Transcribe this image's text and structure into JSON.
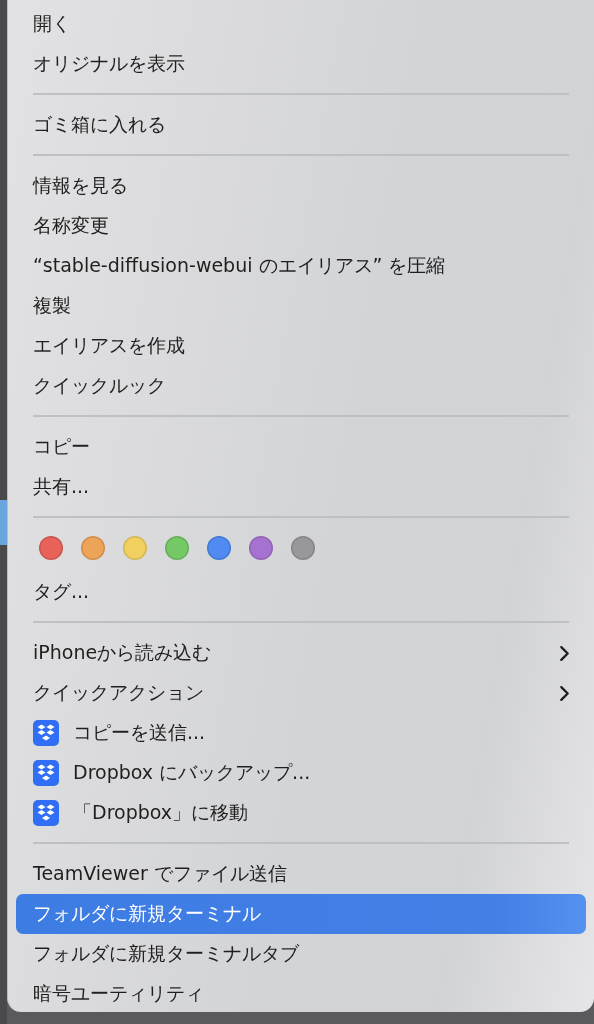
{
  "menu": {
    "items": [
      {
        "kind": "item",
        "label": "開く",
        "selected": false
      },
      {
        "kind": "item",
        "label": "オリジナルを表示",
        "selected": false
      },
      {
        "kind": "separator"
      },
      {
        "kind": "item",
        "label": "ゴミ箱に入れる",
        "selected": false
      },
      {
        "kind": "separator"
      },
      {
        "kind": "item",
        "label": "情報を見る",
        "selected": false
      },
      {
        "kind": "item",
        "label": "名称変更",
        "selected": false
      },
      {
        "kind": "item",
        "label": "“stable-diffusion-webui のエイリアス” を圧縮",
        "selected": false
      },
      {
        "kind": "item",
        "label": "複製",
        "selected": false
      },
      {
        "kind": "item",
        "label": "エイリアスを作成",
        "selected": false
      },
      {
        "kind": "item",
        "label": "クイックルック",
        "selected": false
      },
      {
        "kind": "separator"
      },
      {
        "kind": "item",
        "label": "コピー",
        "selected": false
      },
      {
        "kind": "item",
        "label": "共有...",
        "selected": false
      },
      {
        "kind": "separator"
      },
      {
        "kind": "tags",
        "tags": [
          {
            "color": "#e8625a"
          },
          {
            "color": "#eda358"
          },
          {
            "color": "#f2d060"
          },
          {
            "color": "#74c866"
          },
          {
            "color": "#4f8bf0"
          },
          {
            "color": "#a672d0"
          },
          {
            "color": "#98989b"
          }
        ]
      },
      {
        "kind": "item",
        "label": "タグ...",
        "selected": false
      },
      {
        "kind": "separator"
      },
      {
        "kind": "submenu",
        "label": "iPhoneから読み込む",
        "selected": false
      },
      {
        "kind": "submenu",
        "label": "クイックアクション",
        "selected": false
      },
      {
        "kind": "dropbox",
        "label": "コピーを送信...",
        "selected": false
      },
      {
        "kind": "dropbox",
        "label": "Dropbox にバックアップ...",
        "selected": false
      },
      {
        "kind": "dropbox",
        "label": "「Dropbox」に移動",
        "selected": false
      },
      {
        "kind": "separator"
      },
      {
        "kind": "item",
        "label": "TeamViewer でファイル送信",
        "selected": false
      },
      {
        "kind": "item",
        "label": "フォルダに新規ターミナル",
        "selected": true
      },
      {
        "kind": "item",
        "label": "フォルダに新規ターミナルタブ",
        "selected": false
      },
      {
        "kind": "item",
        "label": "暗号ユーティリティ",
        "selected": false
      }
    ]
  }
}
